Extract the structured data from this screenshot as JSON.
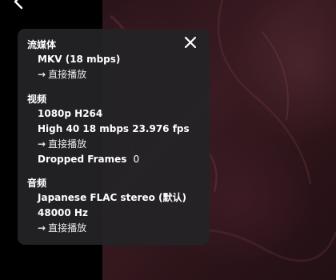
{
  "panel": {
    "sections": [
      {
        "title": "流媒体",
        "lines": [
          "MKV (18 mbps)"
        ],
        "action_arrow": "→",
        "action": "直接播放"
      },
      {
        "title": "视频",
        "lines": [
          "1080p H264",
          "High 40 18 mbps 23.976 fps"
        ],
        "action_arrow": "→",
        "action": "直接播放",
        "dropped_frames_label": "Dropped Frames",
        "dropped_frames_value": "0"
      },
      {
        "title": "音频",
        "lines": [
          "Japanese FLAC stereo (默认)",
          "48000 Hz"
        ],
        "action_arrow": "→",
        "action": "直接播放"
      }
    ]
  },
  "icons": {
    "back": "chevron-left-icon",
    "close": "close-icon"
  },
  "colors": {
    "panel_bg": "#242426",
    "text": "#ffffff",
    "video_tint": "#3a1b22"
  }
}
